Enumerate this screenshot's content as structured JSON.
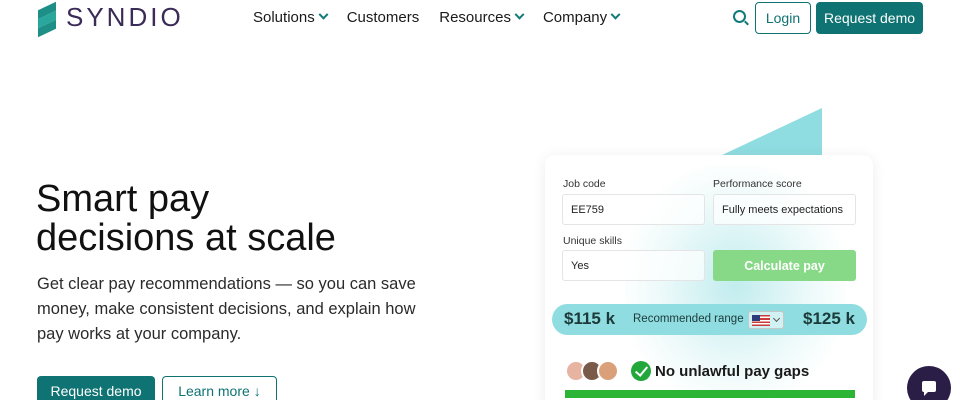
{
  "brand": {
    "name": "SYNDIO",
    "accent": "#0f7373",
    "logo_color": "#3a2b57"
  },
  "nav": {
    "items": [
      {
        "label": "Solutions",
        "has_dropdown": true
      },
      {
        "label": "Customers",
        "has_dropdown": false
      },
      {
        "label": "Resources",
        "has_dropdown": true
      },
      {
        "label": "Company",
        "has_dropdown": true
      }
    ],
    "search_icon": "search-icon",
    "login_label": "Login",
    "request_demo_label": "Request demo"
  },
  "hero": {
    "title_line1": "Smart pay",
    "title_line2": "decisions at scale",
    "subtitle": "Get clear pay recommendations — so you can save money, make consistent decisions, and explain how pay works at your company.",
    "primary_cta": "Request demo",
    "secondary_cta": "Learn more",
    "secondary_cta_icon": "arrow-down-icon"
  },
  "card": {
    "job_code_label": "Job code",
    "job_code_value": "EE759",
    "performance_label": "Performance score",
    "performance_value": "Fully meets expectations",
    "skills_label": "Unique skills",
    "skills_value": "Yes",
    "calculate_label": "Calculate pay",
    "range_low": "$115 k",
    "range_label": "Recommended range",
    "range_high": "$125 k",
    "country_flag": "us-flag-icon",
    "gaps_label": "No unlawful pay gaps",
    "gaps_icon": "check-circle-icon",
    "colors": {
      "calculate": "#87d987",
      "range": "#8fdde0",
      "gaps_bar": "#2cb534"
    }
  },
  "chat": {
    "icon": "chat-icon",
    "color": "#2b1e46"
  }
}
